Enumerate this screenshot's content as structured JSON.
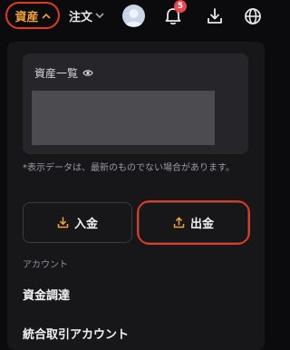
{
  "nav": {
    "assets_label": "資産",
    "orders_label": "注文",
    "notification_count": "5"
  },
  "overview": {
    "title": "資産一覧"
  },
  "notice": "*表示データは、最新のものでない場合があります。",
  "actions": {
    "deposit_label": "入金",
    "withdraw_label": "出金"
  },
  "section": {
    "label": "アカウント",
    "items": [
      {
        "label": "資金調達"
      },
      {
        "label": "統合取引アカウント"
      }
    ]
  },
  "colors": {
    "accent": "#f3a23a",
    "highlight": "#e23b1f",
    "badge": "#e5484d"
  }
}
